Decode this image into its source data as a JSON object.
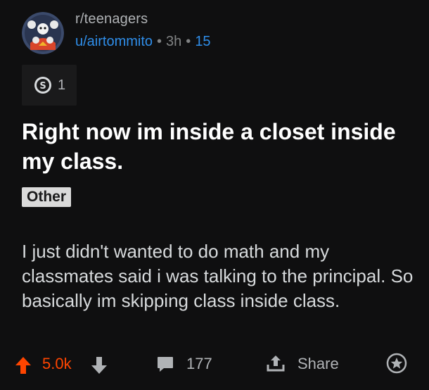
{
  "header": {
    "subreddit": "r/teenagers",
    "username": "u/airtommito",
    "separator": "•",
    "age": "3h",
    "points": "15"
  },
  "award": {
    "icon": "silver-award-icon",
    "count": "1"
  },
  "post": {
    "title": "Right now im inside a closet inside my class.",
    "flair": "Other",
    "body": "I just didn't wanted to do math and my classmates said i was talking to the principal. So basically im skipping class inside class."
  },
  "actions": {
    "score": "5.0k",
    "comments": "177",
    "share_label": "Share"
  },
  "colors": {
    "background": "#0f0f10",
    "upvote": "#ff4500",
    "link": "#2f8eea"
  }
}
